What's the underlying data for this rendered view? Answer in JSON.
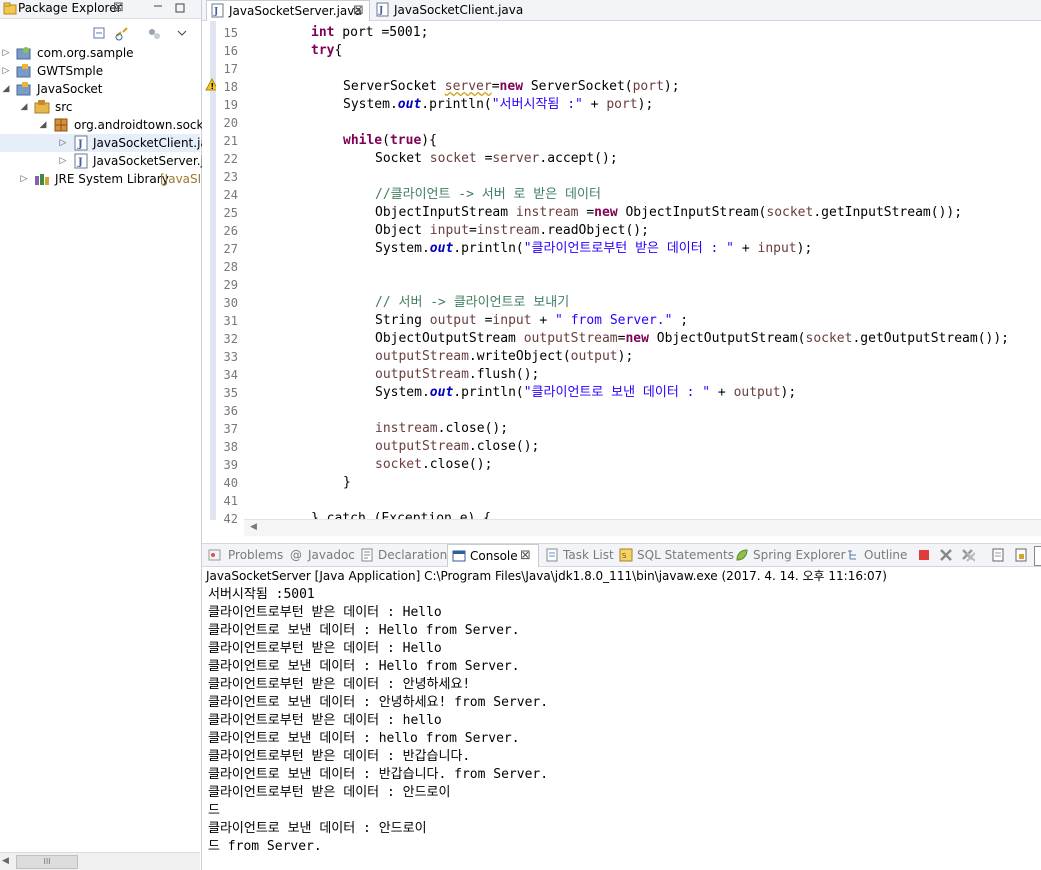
{
  "explorer": {
    "tab_label": "Package Explorer",
    "close_glyph": "⊠",
    "tree": [
      {
        "label": "com.org.sample",
        "icon": "project-icon",
        "arrow": "▷"
      },
      {
        "label": "GWTSmple",
        "icon": "project-icon",
        "arrow": "▷"
      },
      {
        "label": "JavaSocket",
        "icon": "project-icon",
        "arrow": "◢"
      },
      {
        "label": "src",
        "icon": "source-folder-icon",
        "arrow": "◢"
      },
      {
        "label": "org.androidtown.socke",
        "icon": "package-icon",
        "arrow": "◢"
      },
      {
        "label": "JavaSocketClient.jav",
        "icon": "java-file-icon",
        "arrow": "▷"
      },
      {
        "label": "JavaSocketServer.ja",
        "icon": "java-file-icon",
        "arrow": "▷"
      },
      {
        "label": "JRE System Library",
        "suffix": "[JavaSE",
        "icon": "library-icon",
        "arrow": "▷"
      }
    ],
    "hscroll_thumb": "III"
  },
  "editor": {
    "tabs": [
      {
        "label": "JavaSocketServer.java",
        "close": "⊠",
        "active": true
      },
      {
        "label": "JavaSocketClient.java",
        "active": false
      }
    ],
    "line_numbers": [
      "15",
      "16",
      "17",
      "18",
      "19",
      "20",
      "21",
      "22",
      "23",
      "24",
      "25",
      "26",
      "27",
      "28",
      "29",
      "30",
      "31",
      "32",
      "33",
      "34",
      "35",
      "36",
      "37",
      "38",
      "39",
      "40",
      "41",
      "42"
    ],
    "lines": {
      "l15a": "int",
      "l15b": " port =5001;",
      "l16a": "try",
      "l16b": "{",
      "l18a": "ServerSocket ",
      "l18b": "server",
      "l18c": "=",
      "l18d": "new",
      "l18e": " ServerSocket(",
      "l18f": "port",
      "l18g": ");",
      "l19a": "System.",
      "l19b": "out",
      "l19c": ".println(",
      "l19d": "\"서버시작됨 :\"",
      "l19e": " + ",
      "l19f": "port",
      "l19g": ");",
      "l21a": "while",
      "l21b": "(",
      "l21c": "true",
      "l21d": "){",
      "l22a": "Socket ",
      "l22b": "socket",
      "l22c": " =",
      "l22d": "server",
      "l22e": ".accept();",
      "l24": "//클라이언트 -> 서버 로 받은 데이터",
      "l25a": "ObjectInputStream ",
      "l25b": "instream",
      "l25c": " =",
      "l25d": "new",
      "l25e": " ObjectInputStream(",
      "l25f": "socket",
      "l25g": ".getInputStream());",
      "l26a": "Object ",
      "l26b": "input",
      "l26c": "=",
      "l26d": "instream",
      "l26e": ".readObject();",
      "l27a": "System.",
      "l27b": "out",
      "l27c": ".println(",
      "l27d": "\"클라이언트로부턴 받은 데이터 : \"",
      "l27e": " + ",
      "l27f": "input",
      "l27g": ");",
      "l30": "// 서버 -> 클라이언트로 보내기",
      "l31a": "String ",
      "l31b": "output",
      "l31c": " =",
      "l31d": "input",
      "l31e": " + ",
      "l31f": "\" from Server.\"",
      "l31g": " ;",
      "l32a": "ObjectOutputStream ",
      "l32b": "outputStream",
      "l32c": "=",
      "l32d": "new",
      "l32e": " ObjectOutputStream(",
      "l32f": "socket",
      "l32g": ".getOutputStream());",
      "l33a": "outputStream",
      "l33b": ".writeObject(",
      "l33c": "output",
      "l33d": ");",
      "l34a": "outputStream",
      "l34b": ".flush();",
      "l35a": "System.",
      "l35b": "out",
      "l35c": ".println(",
      "l35d": "\"클라이언트로 보낸 데이터 : \"",
      "l35e": " + ",
      "l35f": "output",
      "l35g": ");",
      "l37a": "instream",
      "l37b": ".close();",
      "l38a": "outputStream",
      "l38b": ".close();",
      "l39a": "socket",
      "l39b": ".close();",
      "l40": "}",
      "l42": "} catch (Exception e) {"
    }
  },
  "views": {
    "tabs": [
      {
        "label": "Problems",
        "icon": "problems-icon"
      },
      {
        "label": "Javadoc",
        "icon": "javadoc-icon"
      },
      {
        "label": "Declaration",
        "icon": "declaration-icon"
      },
      {
        "label": "Console",
        "icon": "console-icon",
        "active": true,
        "close": "⊠"
      },
      {
        "label": "Task List",
        "icon": "task-list-icon"
      },
      {
        "label": "SQL Statements",
        "icon": "sql-icon"
      },
      {
        "label": "Spring Explorer",
        "icon": "spring-icon"
      },
      {
        "label": "Outline",
        "icon": "outline-icon"
      }
    ],
    "javadoc_glyph": "@"
  },
  "console": {
    "description": "JavaSocketServer [Java Application] C:\\Program Files\\Java\\jdk1.8.0_111\\bin\\javaw.exe (2017. 4. 14. 오후 11:16:07)",
    "output": [
      "서버시작됨 :5001",
      "클라이언트로부턴 받은 데이터 : Hello",
      "클라이언트로 보낸 데이터 : Hello from Server.",
      "클라이언트로부턴 받은 데이터 : Hello",
      "클라이언트로 보낸 데이터 : Hello from Server.",
      "클라이언트로부턴 받은 데이터 : 안녕하세요!",
      "클라이언트로 보낸 데이터 : 안녕하세요! from Server.",
      "클라이언트로부턴 받은 데이터 : hello",
      "클라이언트로 보낸 데이터 : hello from Server.",
      "클라이언트로부턴 받은 데이터 : 반갑습니다.",
      "클라이언트로 보낸 데이터 : 반갑습니다. from Server.",
      "클라이언트로부턴 받은 데이터 : 안드로이",
      "드",
      "클라이언트로 보낸 데이터 : 안드로이",
      "드 from Server."
    ]
  },
  "colors": {
    "keyword": "#7f0055",
    "string": "#2a00ff",
    "comment": "#3f7f5f",
    "field": "#0000c0",
    "local_var": "#6a3e3e",
    "current_line": "#e8f2fe"
  }
}
